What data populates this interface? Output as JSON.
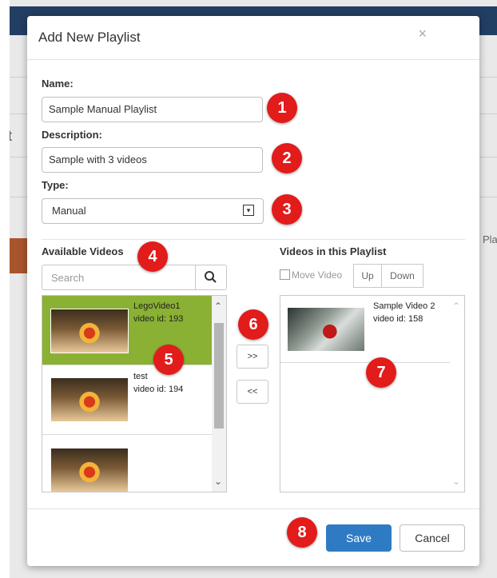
{
  "background": {
    "left_char": "t",
    "right_text": "Pla"
  },
  "modal": {
    "title": "Add New Playlist",
    "close_symbol": "×",
    "name": {
      "label": "Name:",
      "value": "Sample Manual Playlist"
    },
    "description": {
      "label": "Description:",
      "value": "Sample with 3 videos"
    },
    "type": {
      "label": "Type:",
      "value": "Manual",
      "arrow": "▾"
    },
    "available": {
      "heading": "Available Videos",
      "search_placeholder": "Search",
      "items": [
        {
          "title": "LegoVideo1",
          "id_text": "video id: 193",
          "selected": true
        },
        {
          "title": "test",
          "id_text": "video id: 194",
          "selected": false
        },
        {
          "title": "",
          "id_text": "",
          "selected": false
        }
      ]
    },
    "move": {
      "add_label": ">>",
      "remove_label": "<<"
    },
    "playlist": {
      "heading": "Videos in this Playlist",
      "move_video_label": "Move Video",
      "up_label": "Up",
      "down_label": "Down",
      "items": [
        {
          "title": "Sample Video 2",
          "id_text": "video id: 158"
        }
      ]
    },
    "footer": {
      "save_label": "Save",
      "cancel_label": "Cancel"
    }
  },
  "badges": [
    "1",
    "2",
    "3",
    "4",
    "5",
    "6",
    "7",
    "8"
  ],
  "colors": {
    "badge": "#e21b1b",
    "selected_item": "#8ab034",
    "primary_button": "#2f7bc3",
    "topbar": "#233e63"
  }
}
